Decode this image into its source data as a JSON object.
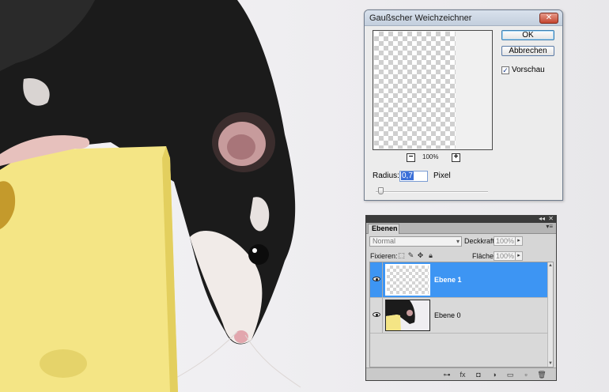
{
  "dialog": {
    "title": "Gaußscher Weichzeichner",
    "close_symbol": "✕",
    "ok_label": "OK",
    "cancel_label": "Abbrechen",
    "preview_checkbox": {
      "label": "Vorschau",
      "checked": true,
      "check_symbol": "✓"
    },
    "zoom": {
      "minus": "−",
      "plus": "+",
      "level": "100%"
    },
    "radius_label": "Radius:",
    "radius_value": "0,7",
    "radius_unit": "Pixel",
    "radius_slider_fraction": 0.02
  },
  "layers_panel": {
    "collapse_symbol": "◂◂",
    "close_symbol": "✕",
    "menu_symbol": "▾≡",
    "tab_label": "Ebenen",
    "blend_mode": "Normal",
    "opacity_label": "Deckkraft:",
    "opacity_value": "100%",
    "lock_label": "Fixieren:",
    "fill_label": "Fläche:",
    "fill_value": "100%",
    "field_arrow": "▸",
    "lock_icons": [
      "transparent-lock-icon",
      "brush-lock-icon",
      "move-lock-icon",
      "padlock-icon"
    ],
    "layers": [
      {
        "name": "Ebene 1",
        "selected": true,
        "visible": true
      },
      {
        "name": "Ebene 0",
        "selected": false,
        "visible": true
      }
    ],
    "footer_icons": [
      "link-icon",
      "fx-icon",
      "mask-icon",
      "adjustment-icon",
      "group-folder-icon",
      "new-layer-icon",
      "trash-icon"
    ],
    "footer_symbols": [
      "⊶",
      "fx",
      "◘",
      "◑",
      "▭",
      "▫",
      "🗑"
    ]
  }
}
